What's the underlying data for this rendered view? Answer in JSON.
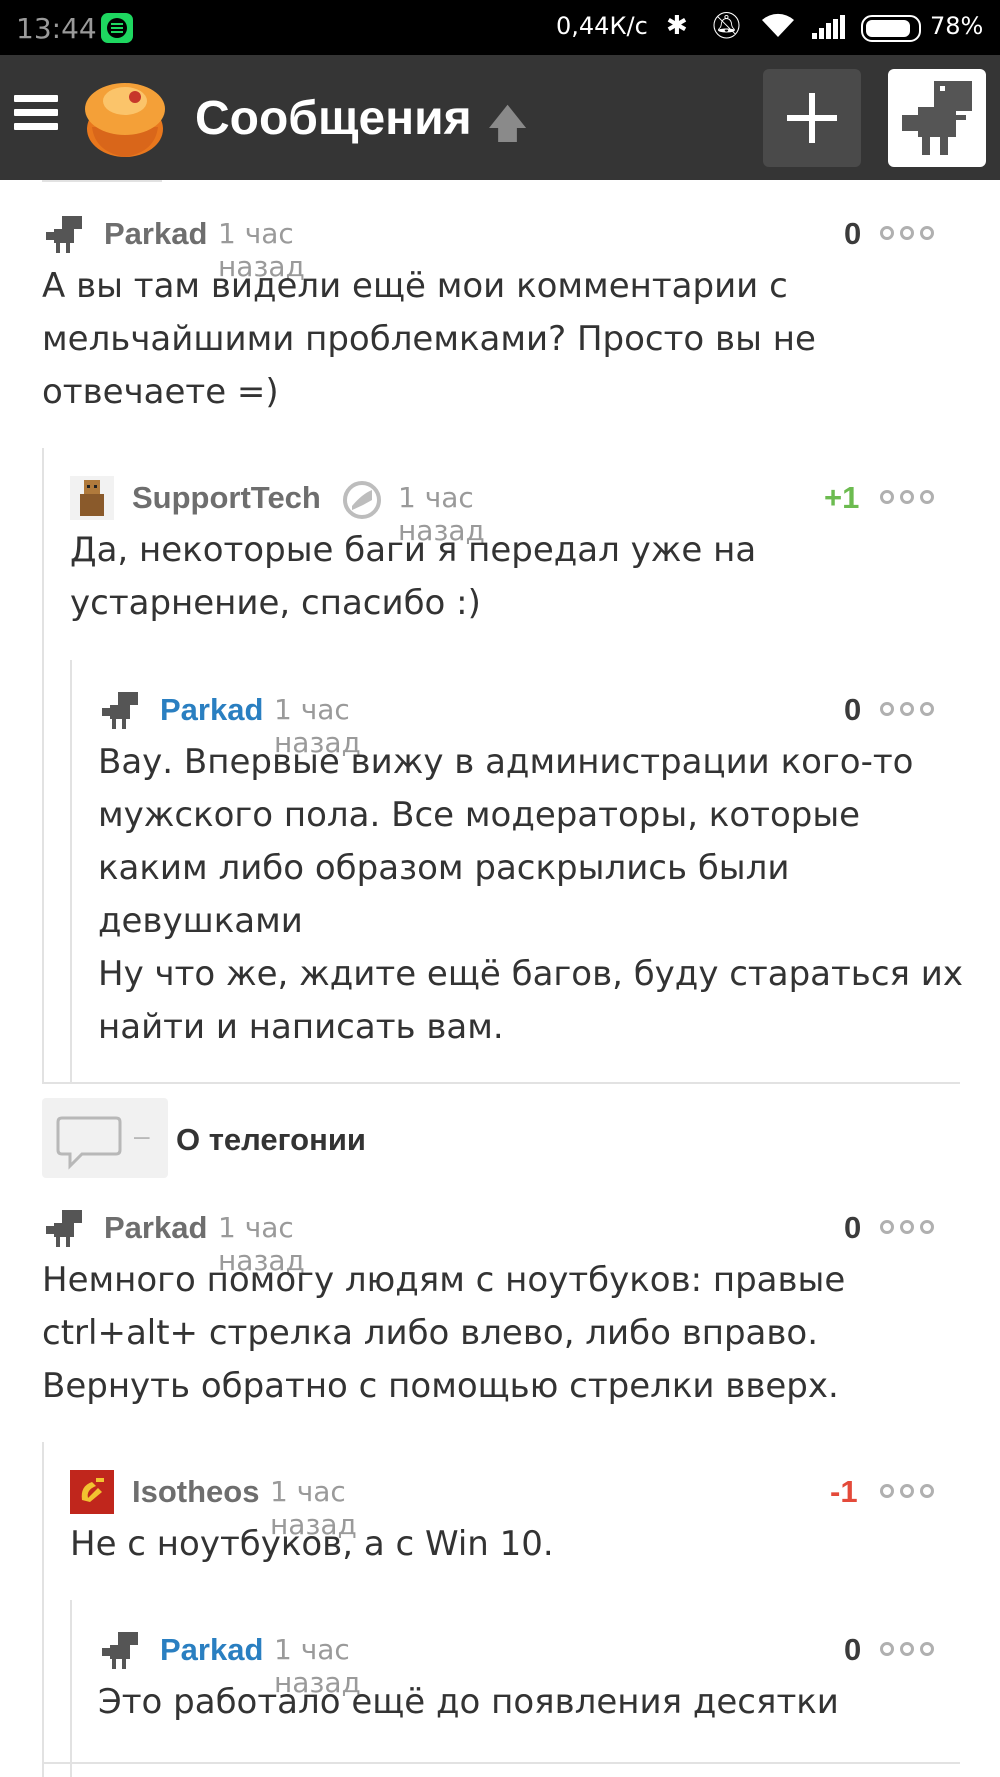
{
  "status": {
    "time": "13:44",
    "net_speed": "0,44К/с",
    "battery": "78%"
  },
  "header": {
    "title": "Сообщения"
  },
  "topics": [
    {
      "title": "О телегонии",
      "count": "–"
    }
  ],
  "comments": [
    {
      "author": "Parkad",
      "time": "1 час назад",
      "score": "0",
      "text": "А вы там видели ещё мои комментарии с мельчайшими проблемками? Просто вы не отвечаете =)"
    },
    {
      "author": "SupportTech",
      "time": "1 час назад",
      "score": "+1",
      "text": "Да, некоторые баги я передал уже на устарнение, спасибо :)"
    },
    {
      "author": "Parkad",
      "time": "1 час назад",
      "score": "0",
      "text_lines": [
        "Вау. Впервые вижу в администрации кого-то",
        "мужского пола. Все модераторы, которые",
        "каким либо образом раскрылись были",
        "девушками",
        "Ну что же, ждите ещё багов, буду стараться их",
        "найти и написать вам."
      ]
    },
    {
      "author": "Parkad",
      "time": "1 час назад",
      "score": "0",
      "text_lines": [
        "Немного помогу людям с ноутбуков: правые",
        "ctrl+alt+ стрелка либо влево, либо вправо.",
        "Вернуть обратно с помощью стрелки вверх."
      ]
    },
    {
      "author": "Isotheos",
      "time": "1 час назад",
      "score": "-1",
      "text": "Не с ноутбуков, а с Win 10."
    },
    {
      "author": "Parkad",
      "time": "1 час назад",
      "score": "0",
      "text": "Это работало ещё до появления десятки"
    }
  ],
  "colors": {
    "header_bg": "#353535",
    "accent_blue": "#2a7fc1",
    "positive": "#6cbb50",
    "negative": "#e44a3a"
  }
}
